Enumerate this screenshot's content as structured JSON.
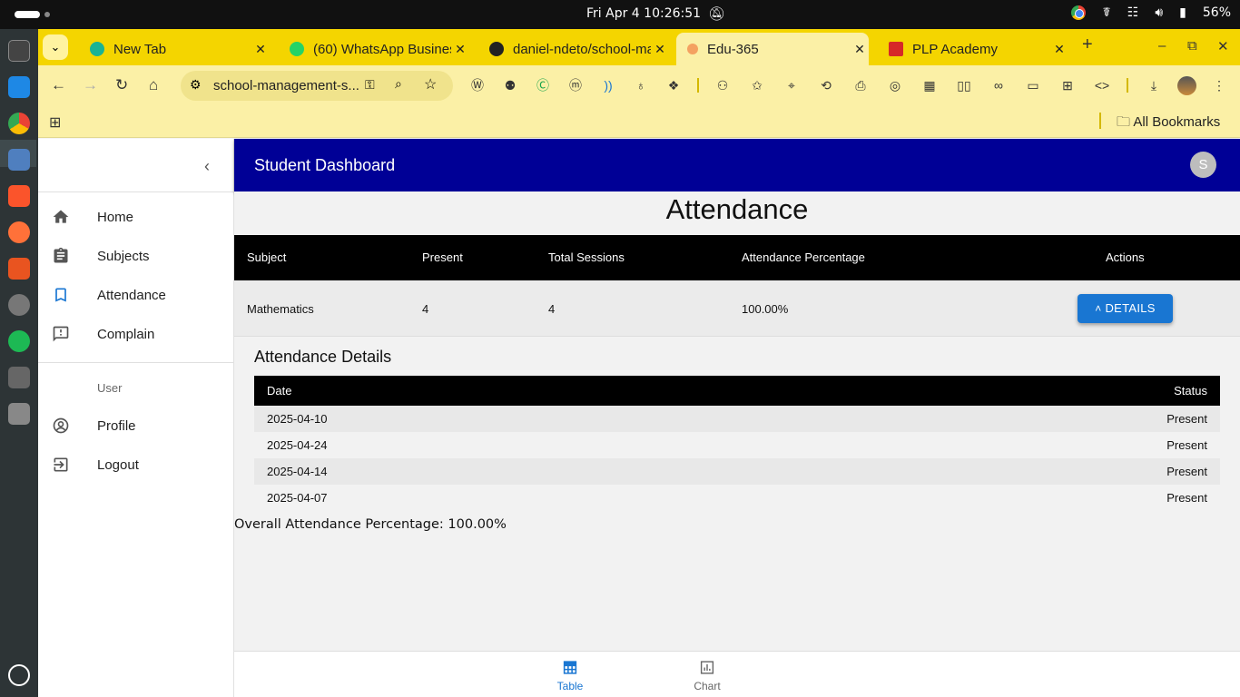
{
  "os": {
    "clock": "Fri Apr 4  10:26:51",
    "battery": "56%"
  },
  "browser": {
    "tabs": [
      {
        "title": "New Tab",
        "favicon_color": "#1ab394"
      },
      {
        "title": "(60) WhatsApp Business",
        "favicon_color": "#25d366"
      },
      {
        "title": "daniel-ndeto/school-ma",
        "favicon_color": "#222222"
      },
      {
        "title": "Edu-365",
        "favicon_color": "#f4a261"
      },
      {
        "title": "PLP Academy",
        "favicon_color": "#d62828"
      }
    ],
    "url": "school-management-s...",
    "bookmarks_label": "All Bookmarks"
  },
  "app": {
    "header_title": "Student Dashboard",
    "avatar_letter": "S",
    "accent": "#000096",
    "button_color": "#1976d2"
  },
  "sidebar": {
    "items": [
      {
        "label": "Home",
        "icon": "home-icon"
      },
      {
        "label": "Subjects",
        "icon": "clipboard-icon"
      },
      {
        "label": "Attendance",
        "icon": "bookmark-icon"
      },
      {
        "label": "Complain",
        "icon": "feedback-icon"
      }
    ],
    "section_label": "User",
    "user_items": [
      {
        "label": "Profile",
        "icon": "account-circle-icon"
      },
      {
        "label": "Logout",
        "icon": "logout-icon"
      }
    ]
  },
  "attendance": {
    "title": "Attendance",
    "headers": [
      "Subject",
      "Present",
      "Total Sessions",
      "Attendance Percentage",
      "Actions"
    ],
    "row": {
      "subject": "Mathematics",
      "present": "4",
      "total": "4",
      "percentage": "100.00%"
    },
    "details_button": "DETAILS",
    "details_title": "Attendance Details",
    "details_headers": [
      "Date",
      "Status"
    ],
    "details_rows": [
      {
        "date": "2025-04-10",
        "status": "Present"
      },
      {
        "date": "2025-04-24",
        "status": "Present"
      },
      {
        "date": "2025-04-14",
        "status": "Present"
      },
      {
        "date": "2025-04-07",
        "status": "Present"
      }
    ],
    "overall": "Overall Attendance Percentage: 100.00%"
  },
  "bottom_nav": [
    {
      "label": "Table",
      "icon": "table-icon",
      "active": true
    },
    {
      "label": "Chart",
      "icon": "chart-icon",
      "active": false
    }
  ]
}
